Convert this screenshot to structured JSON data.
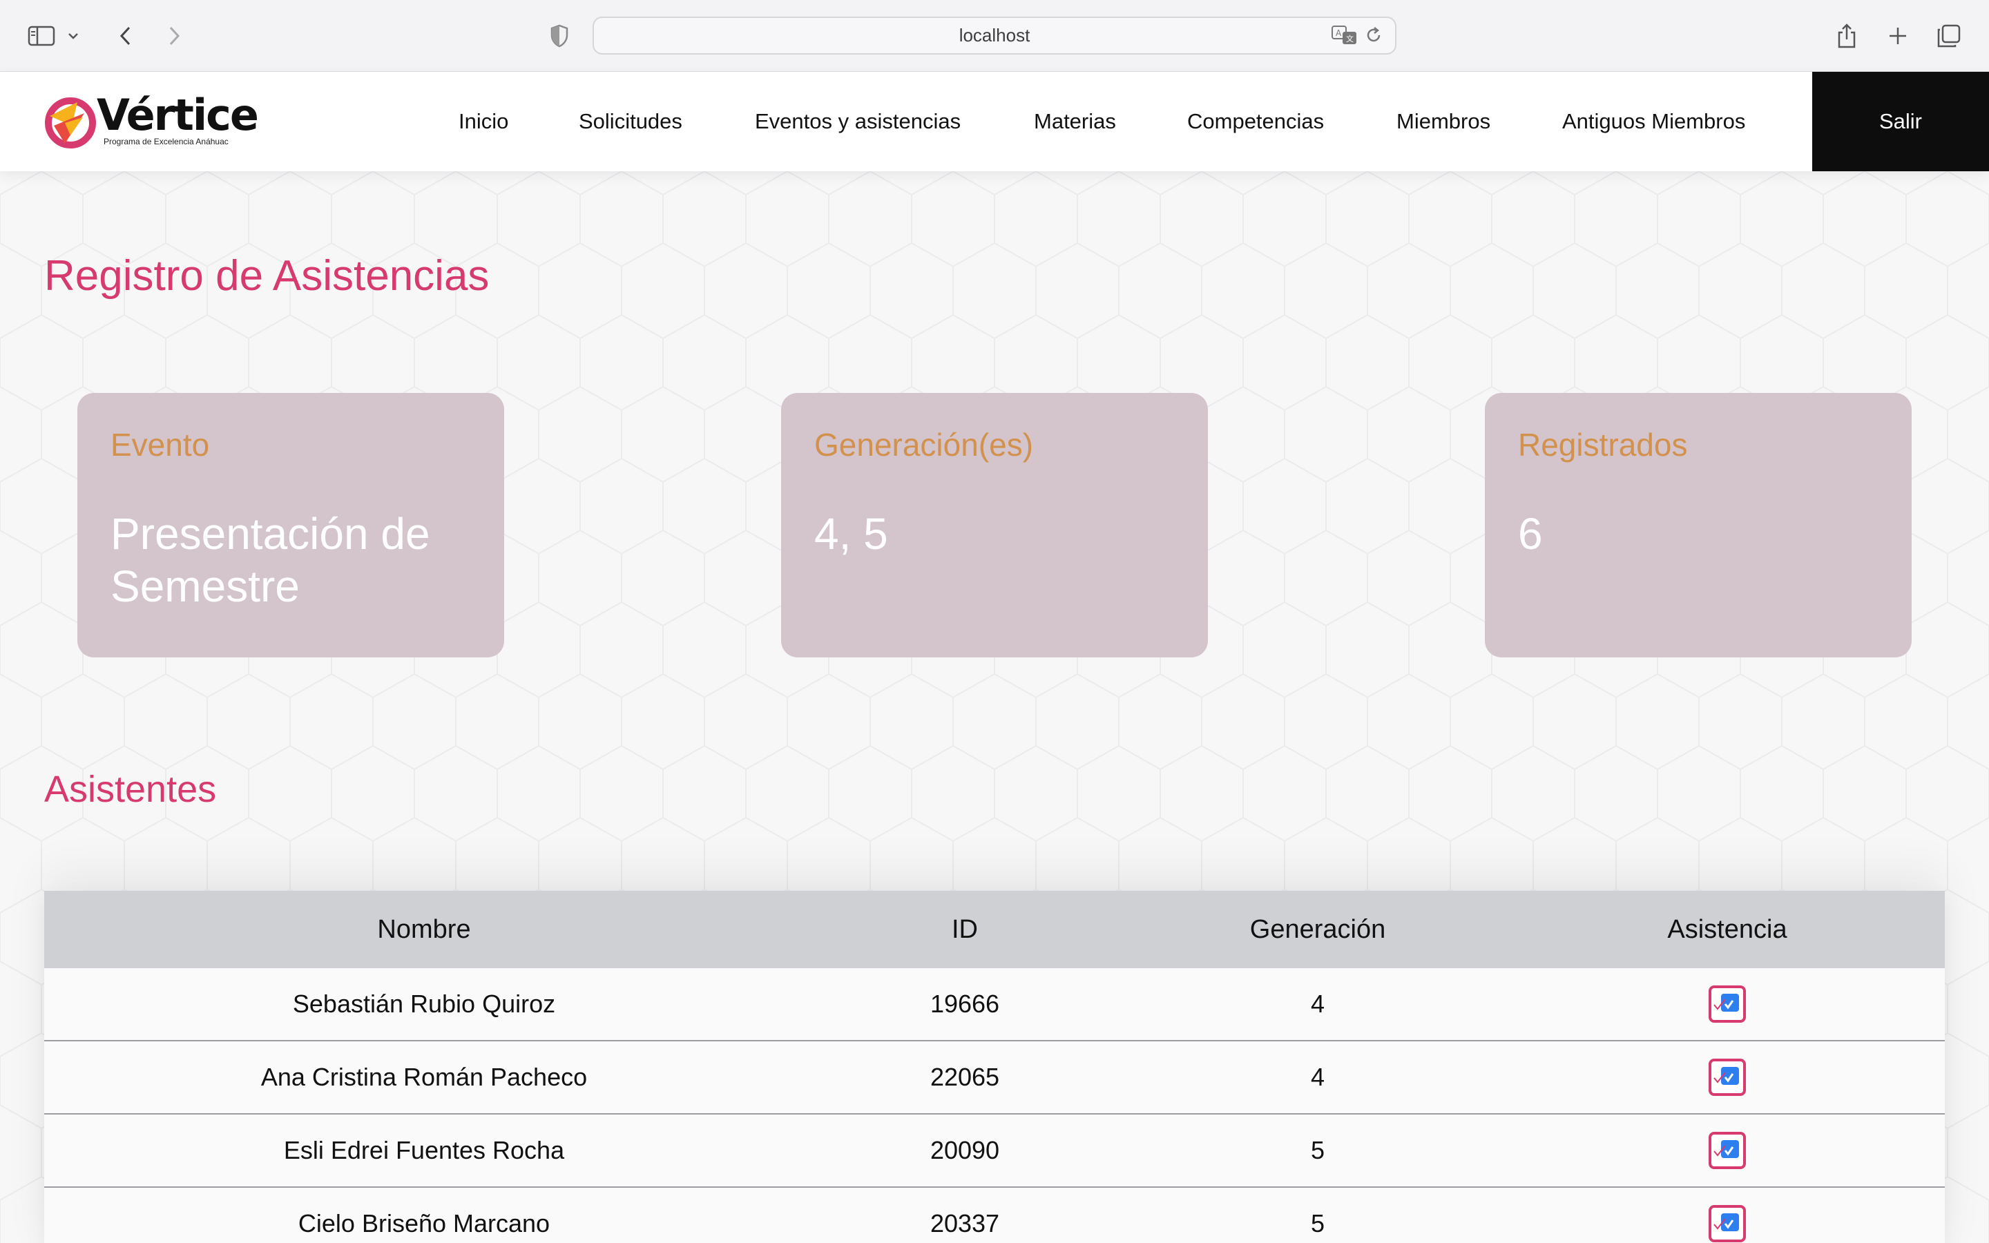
{
  "browser": {
    "url": "localhost"
  },
  "header": {
    "logo_word": "Vértice",
    "logo_tagline": "Programa de Excelencia Anáhuac",
    "nav": [
      "Inicio",
      "Solicitudes",
      "Eventos y asistencias",
      "Materias",
      "Competencias",
      "Miembros",
      "Antiguos Miembros"
    ],
    "logout_label": "Salir"
  },
  "page": {
    "title": "Registro de Asistencias",
    "cards": [
      {
        "label": "Evento",
        "value": "Presentación de Semestre"
      },
      {
        "label": "Generación(es)",
        "value": "4, 5"
      },
      {
        "label": "Registrados",
        "value": "6"
      }
    ],
    "section_title": "Asistentes"
  },
  "table": {
    "columns": [
      "Nombre",
      "ID",
      "Generación",
      "Asistencia"
    ],
    "rows": [
      {
        "name": "Sebastián Rubio Quiroz",
        "id": "19666",
        "generation": "4",
        "attended": true
      },
      {
        "name": "Ana Cristina Román Pacheco",
        "id": "22065",
        "generation": "4",
        "attended": true
      },
      {
        "name": "Esli Edrei Fuentes Rocha",
        "id": "20090",
        "generation": "5",
        "attended": true
      },
      {
        "name": "Cielo Briseño Marcano",
        "id": "20337",
        "generation": "5",
        "attended": true
      }
    ]
  },
  "colors": {
    "accent": "#d63a6e",
    "card_bg": "#d4c4cb",
    "card_label": "#d2914d",
    "checkbox_fill": "#2d7ff0"
  }
}
